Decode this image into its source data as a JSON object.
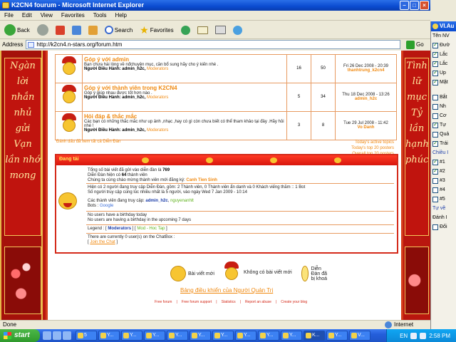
{
  "window": {
    "title": "K2CN4 fourum - Microsoft Internet Explorer"
  },
  "menu": [
    "File",
    "Edit",
    "View",
    "Favorites",
    "Tools",
    "Help"
  ],
  "toolbar": {
    "back": "Back",
    "search": "Search",
    "favorites": "Favorites"
  },
  "address": {
    "label": "Address",
    "url": "http://k2cn4.n-stars.org/forum.htm",
    "go": "Go"
  },
  "banner_left": {
    "text": "Ngàn lời nhắn nhủ gửi Vạn lần nhớ mong"
  },
  "banner_right": {
    "text": "Tình lữ mục Tỷ lần hạnh phúc"
  },
  "forums": [
    {
      "title": "Góp ý với admin",
      "description": "Bạn chưa hài lòng về nđchuyện mục, cần bổ sung hãy cho ý kiến nhé .",
      "moderator_label": "Người Điều Hành:",
      "admin": "admin_h2c,",
      "moderators": "Moderators",
      "topics": "16",
      "posts": "50",
      "last_date": "Fri 26 Dec 2008 - 20:39",
      "last_user": "thanhtrung_k2cn4"
    },
    {
      "title": "Góp ý với thành viên trong K2CN4",
      "description": "Góp ý giúp nhau được tốt hơn nào .",
      "moderator_label": "Người Điều Hành:",
      "admin": "admin_h2c,",
      "moderators": "Moderators",
      "topics": "5",
      "posts": "34",
      "last_date": "Thu 18 Dec 2008 - 13:26",
      "last_user": "admin_h2c"
    },
    {
      "title": "Hỏi đáp & thắc mắc",
      "description": "Các bạn có những thắc mắc như up ảnh ,nhạc ,hay có gì còn chưa biết có thể tham khảo tại đây .Hãy hỏi nhé !",
      "moderator_label": "Người Điều Hành:",
      "admin": "admin_h2c,",
      "moderators": "Moderators",
      "topics": "3",
      "posts": "8",
      "last_date": "Tue 29 Jul 2008 - 11:42",
      "last_user": "Vo Danh"
    }
  ],
  "mark_read": "Đánh dấu đã xem tất cả Diễn Đàn",
  "top_links": [
    "Today's active topics",
    "Today's top 20 posters",
    "Overall top 20 posters"
  ],
  "whoisonline": {
    "header": "Đang tải",
    "total_posts_prefix": "Tổng số bài viết đã gửi vào diễn đàn là ",
    "total_posts": "769",
    "members_prefix": "Diễn Đàn hiện có ",
    "members": "64",
    "members_suffix": " thành viên",
    "newest_prefix": "Chúng ta cùng chào mừng thành viên mới đăng ký: ",
    "newest": "Canh Tien Sinh",
    "online_line": "Hiện có 2 người đang truy cập Diễn Đàn, gồm: 2 Thành viên, 0 Thành viên ẩn danh và 0 Khách viếng thăm :: 1 Bot",
    "record_line": "Số người truy cập cùng lúc nhiều nhất là 5 người, vào ngày Wed 7 Jan 2009 - 10:14",
    "users_prefix": "Các thành viên đang truy cập: ",
    "user1": "admin_h2c",
    "user2": "nguyenanhlt",
    "bots_prefix": "Bots : ",
    "bot": "Google",
    "birthday_today": "No users have a birthday today",
    "birthday_upcoming": "No users are having a birthday in the upcoming 7 days",
    "legend_prefix": "Legend : [ ",
    "legend_mod": "Moderators",
    "legend_mid": " ] [ ",
    "legend_group": "Mod - Hoc Tap",
    "legend_end": " ]",
    "chatbox_line": "There are currently 0 user(s) on the ChatBox :",
    "chatbox_join": "Join the Chat"
  },
  "legend_icons": {
    "new": "Bài viết mới",
    "no_new": "Không có bài viết mới",
    "locked": "Diễn Đàn đã bị khoá"
  },
  "admin_link": "Bảng điều khiển của Người Quản Trị",
  "footer": [
    "Free forum",
    "Free forum support",
    "Statistics",
    "Report an abuse",
    "Create your blog"
  ],
  "status": {
    "text": "Done",
    "zone": "Internet"
  },
  "side_panel": {
    "title": "VI.Au",
    "rows": [
      "Tên NV",
      "Đườ",
      "Lắc",
      "Lắc",
      "Up",
      "Mặt",
      "Bắt",
      "Nh",
      "Cơ",
      "Tự",
      "Quả",
      "Trái",
      "Chiều I",
      "#1",
      "#2",
      "#3",
      "#4",
      "#5",
      "Tự về",
      "Đánh I",
      "Đổi"
    ]
  },
  "taskbar": {
    "start": "start",
    "tasks": [
      "5",
      "Y...",
      "Y...",
      "Y...",
      "Y...",
      "Y...",
      "Y...",
      "Y...",
      "Y...",
      "Y...",
      "K...",
      "Y...",
      "V..."
    ],
    "lang": "EN",
    "time": "2:58 PM"
  }
}
